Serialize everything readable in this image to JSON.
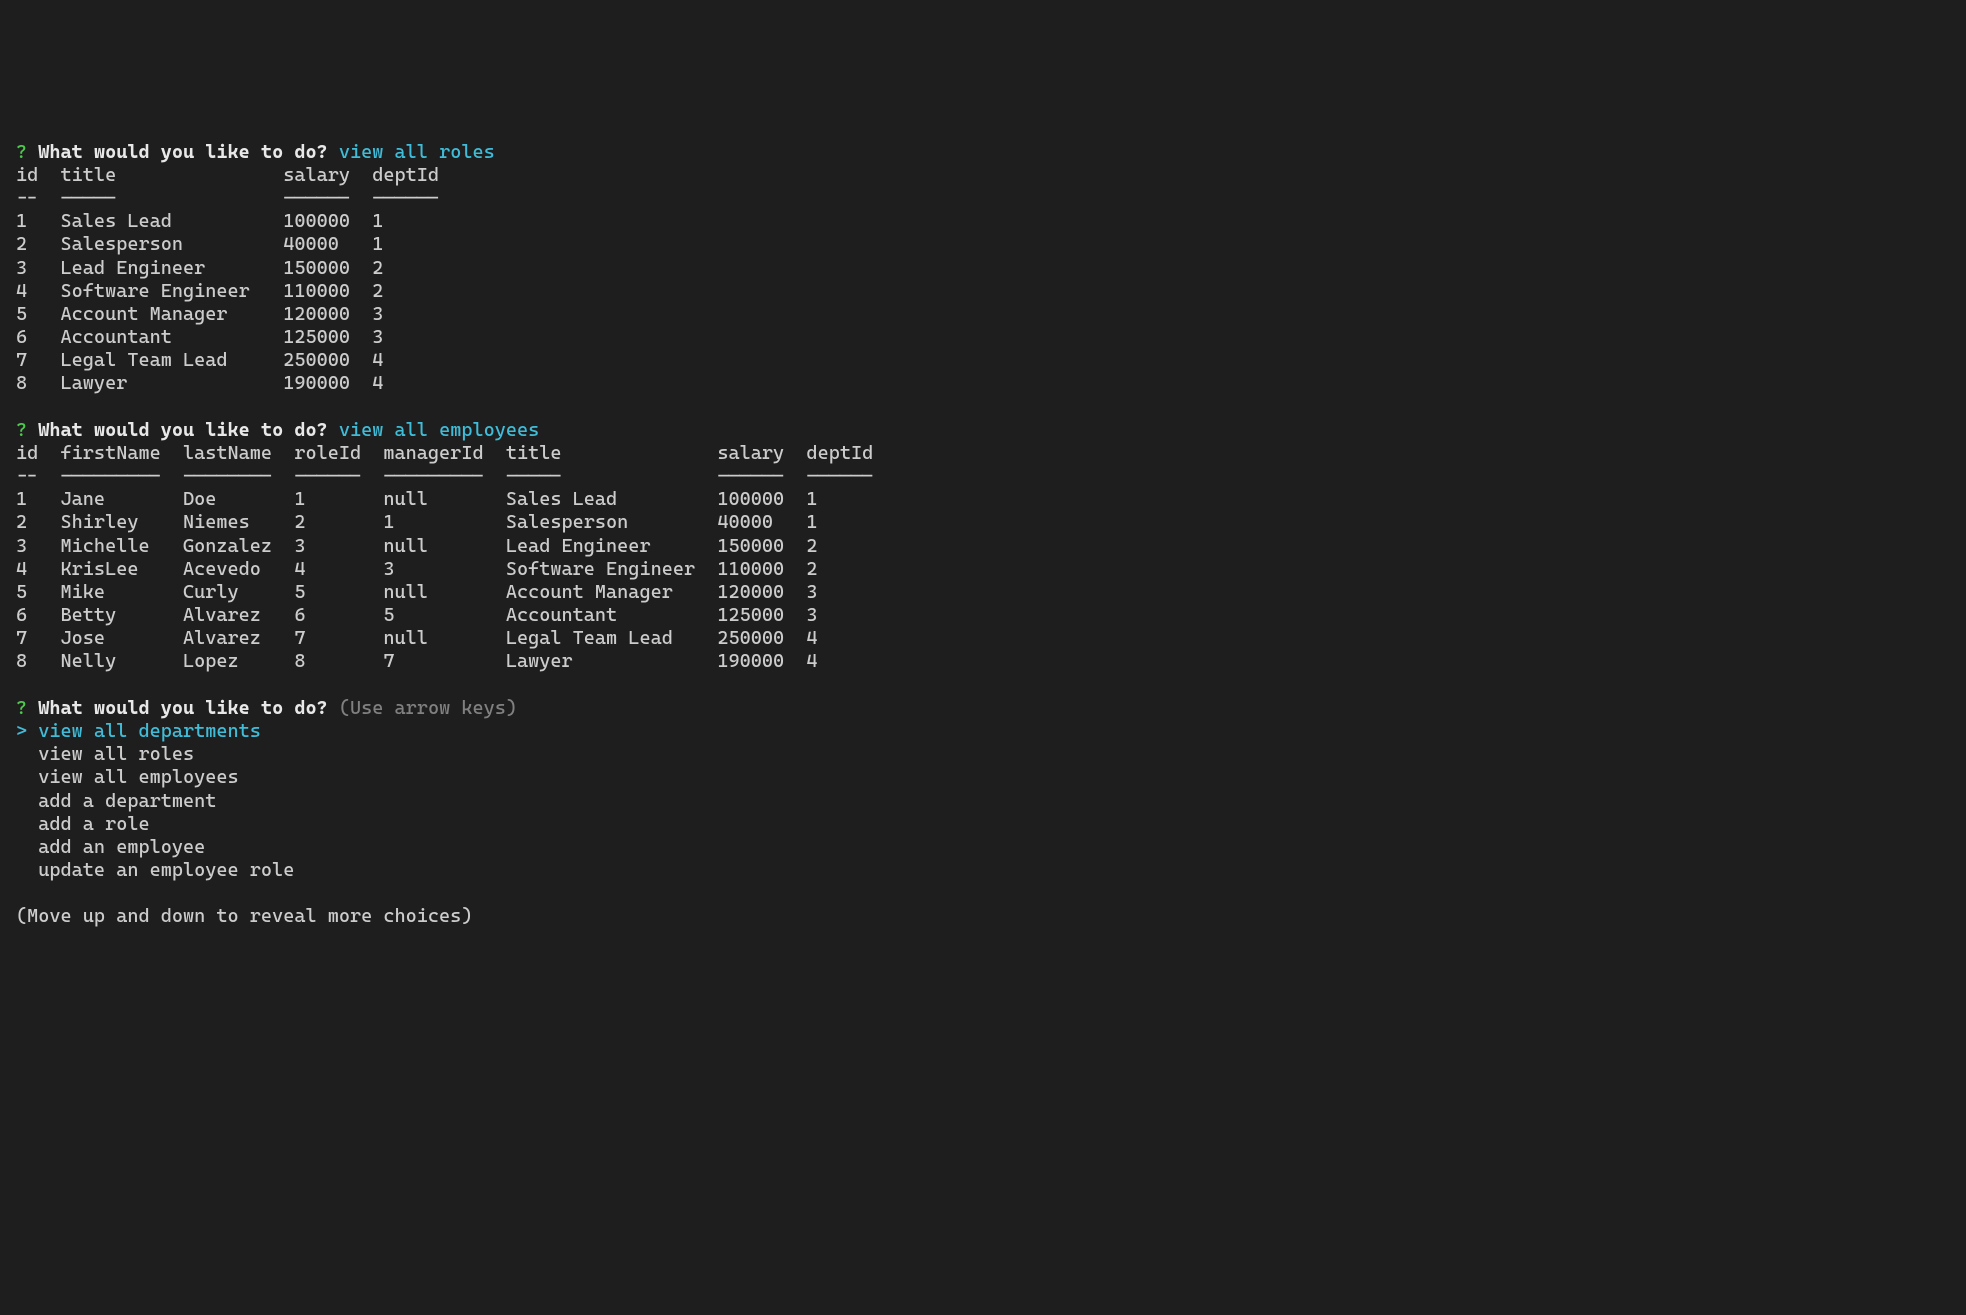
{
  "prompt_marker": "?",
  "prompt_text": "What would you like to do?",
  "answer1": "view all roles",
  "answer2": "view all employees",
  "hint": "(Use arrow keys)",
  "pointer": ">",
  "move_hint": "(Move up and down to reveal more choices)",
  "roles_table": {
    "columns": [
      "id",
      "title",
      "salary",
      "deptId"
    ],
    "widths": [
      4,
      20,
      8,
      6
    ],
    "rows": [
      {
        "id": "1",
        "title": "Sales Lead",
        "salary": "100000",
        "deptId": "1"
      },
      {
        "id": "2",
        "title": "Salesperson",
        "salary": "40000",
        "deptId": "1"
      },
      {
        "id": "3",
        "title": "Lead Engineer",
        "salary": "150000",
        "deptId": "2"
      },
      {
        "id": "4",
        "title": "Software Engineer",
        "salary": "110000",
        "deptId": "2"
      },
      {
        "id": "5",
        "title": "Account Manager",
        "salary": "120000",
        "deptId": "3"
      },
      {
        "id": "6",
        "title": "Accountant",
        "salary": "125000",
        "deptId": "3"
      },
      {
        "id": "7",
        "title": "Legal Team Lead",
        "salary": "250000",
        "deptId": "4"
      },
      {
        "id": "8",
        "title": "Lawyer",
        "salary": "190000",
        "deptId": "4"
      }
    ]
  },
  "employees_table": {
    "columns": [
      "id",
      "firstName",
      "lastName",
      "roleId",
      "managerId",
      "title",
      "salary",
      "deptId"
    ],
    "widths": [
      4,
      11,
      10,
      8,
      11,
      19,
      8,
      6
    ],
    "rows": [
      {
        "id": "1",
        "firstName": "Jane",
        "lastName": "Doe",
        "roleId": "1",
        "managerId": "null",
        "title": "Sales Lead",
        "salary": "100000",
        "deptId": "1"
      },
      {
        "id": "2",
        "firstName": "Shirley",
        "lastName": "Niemes",
        "roleId": "2",
        "managerId": "1",
        "title": "Salesperson",
        "salary": "40000",
        "deptId": "1"
      },
      {
        "id": "3",
        "firstName": "Michelle",
        "lastName": "Gonzalez",
        "roleId": "3",
        "managerId": "null",
        "title": "Lead Engineer",
        "salary": "150000",
        "deptId": "2"
      },
      {
        "id": "4",
        "firstName": "KrisLee",
        "lastName": "Acevedo",
        "roleId": "4",
        "managerId": "3",
        "title": "Software Engineer",
        "salary": "110000",
        "deptId": "2"
      },
      {
        "id": "5",
        "firstName": "Mike",
        "lastName": "Curly",
        "roleId": "5",
        "managerId": "null",
        "title": "Account Manager",
        "salary": "120000",
        "deptId": "3"
      },
      {
        "id": "6",
        "firstName": "Betty",
        "lastName": "Alvarez",
        "roleId": "6",
        "managerId": "5",
        "title": "Accountant",
        "salary": "125000",
        "deptId": "3"
      },
      {
        "id": "7",
        "firstName": "Jose",
        "lastName": "Alvarez",
        "roleId": "7",
        "managerId": "null",
        "title": "Legal Team Lead",
        "salary": "250000",
        "deptId": "4"
      },
      {
        "id": "8",
        "firstName": "Nelly",
        "lastName": "Lopez",
        "roleId": "8",
        "managerId": "7",
        "title": "Lawyer",
        "salary": "190000",
        "deptId": "4"
      }
    ]
  },
  "menu": {
    "selected_index": 0,
    "options": [
      "view all departments",
      "view all roles",
      "view all employees",
      "add a department",
      "add a role",
      "add an employee",
      "update an employee role"
    ]
  }
}
